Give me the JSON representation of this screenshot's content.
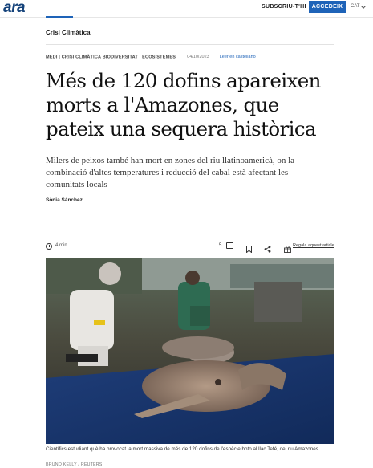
{
  "header": {
    "logo": "ara",
    "subscribe_label": "SUBSCRIU-T'HI",
    "login_label": "ACCEDEIX",
    "language": "CAT"
  },
  "section": "Crisi Climàtica",
  "meta": {
    "tags": "MEDI | CRISI CLIMÀTICA BIODIVERSITAT | ECOSISTEMES",
    "date": "04/10/2023",
    "read_in_spanish": "Leer en castellano"
  },
  "article": {
    "headline": "Més de 120 dofins apareixen morts a l'Amazones, que pateix una sequera històrica",
    "standfirst": "Milers de peixos també han mort en zones del riu llatinoamericà, on la combinació d'altes temperatures i reducció del cabal està afectant les comunitats locals",
    "author": "Sònia Sánchez"
  },
  "toolbar": {
    "read_time": "4 min",
    "comments_count": "5",
    "gift_label": "Regala aquest article"
  },
  "photo": {
    "caption": "Científics estudiant què ha provocat la mort massiva de més de 120 dofins de l'espècie boto al llac Tefé, del riu Amazones.",
    "credit": "BRUNO KELLY / REUTERS"
  }
}
